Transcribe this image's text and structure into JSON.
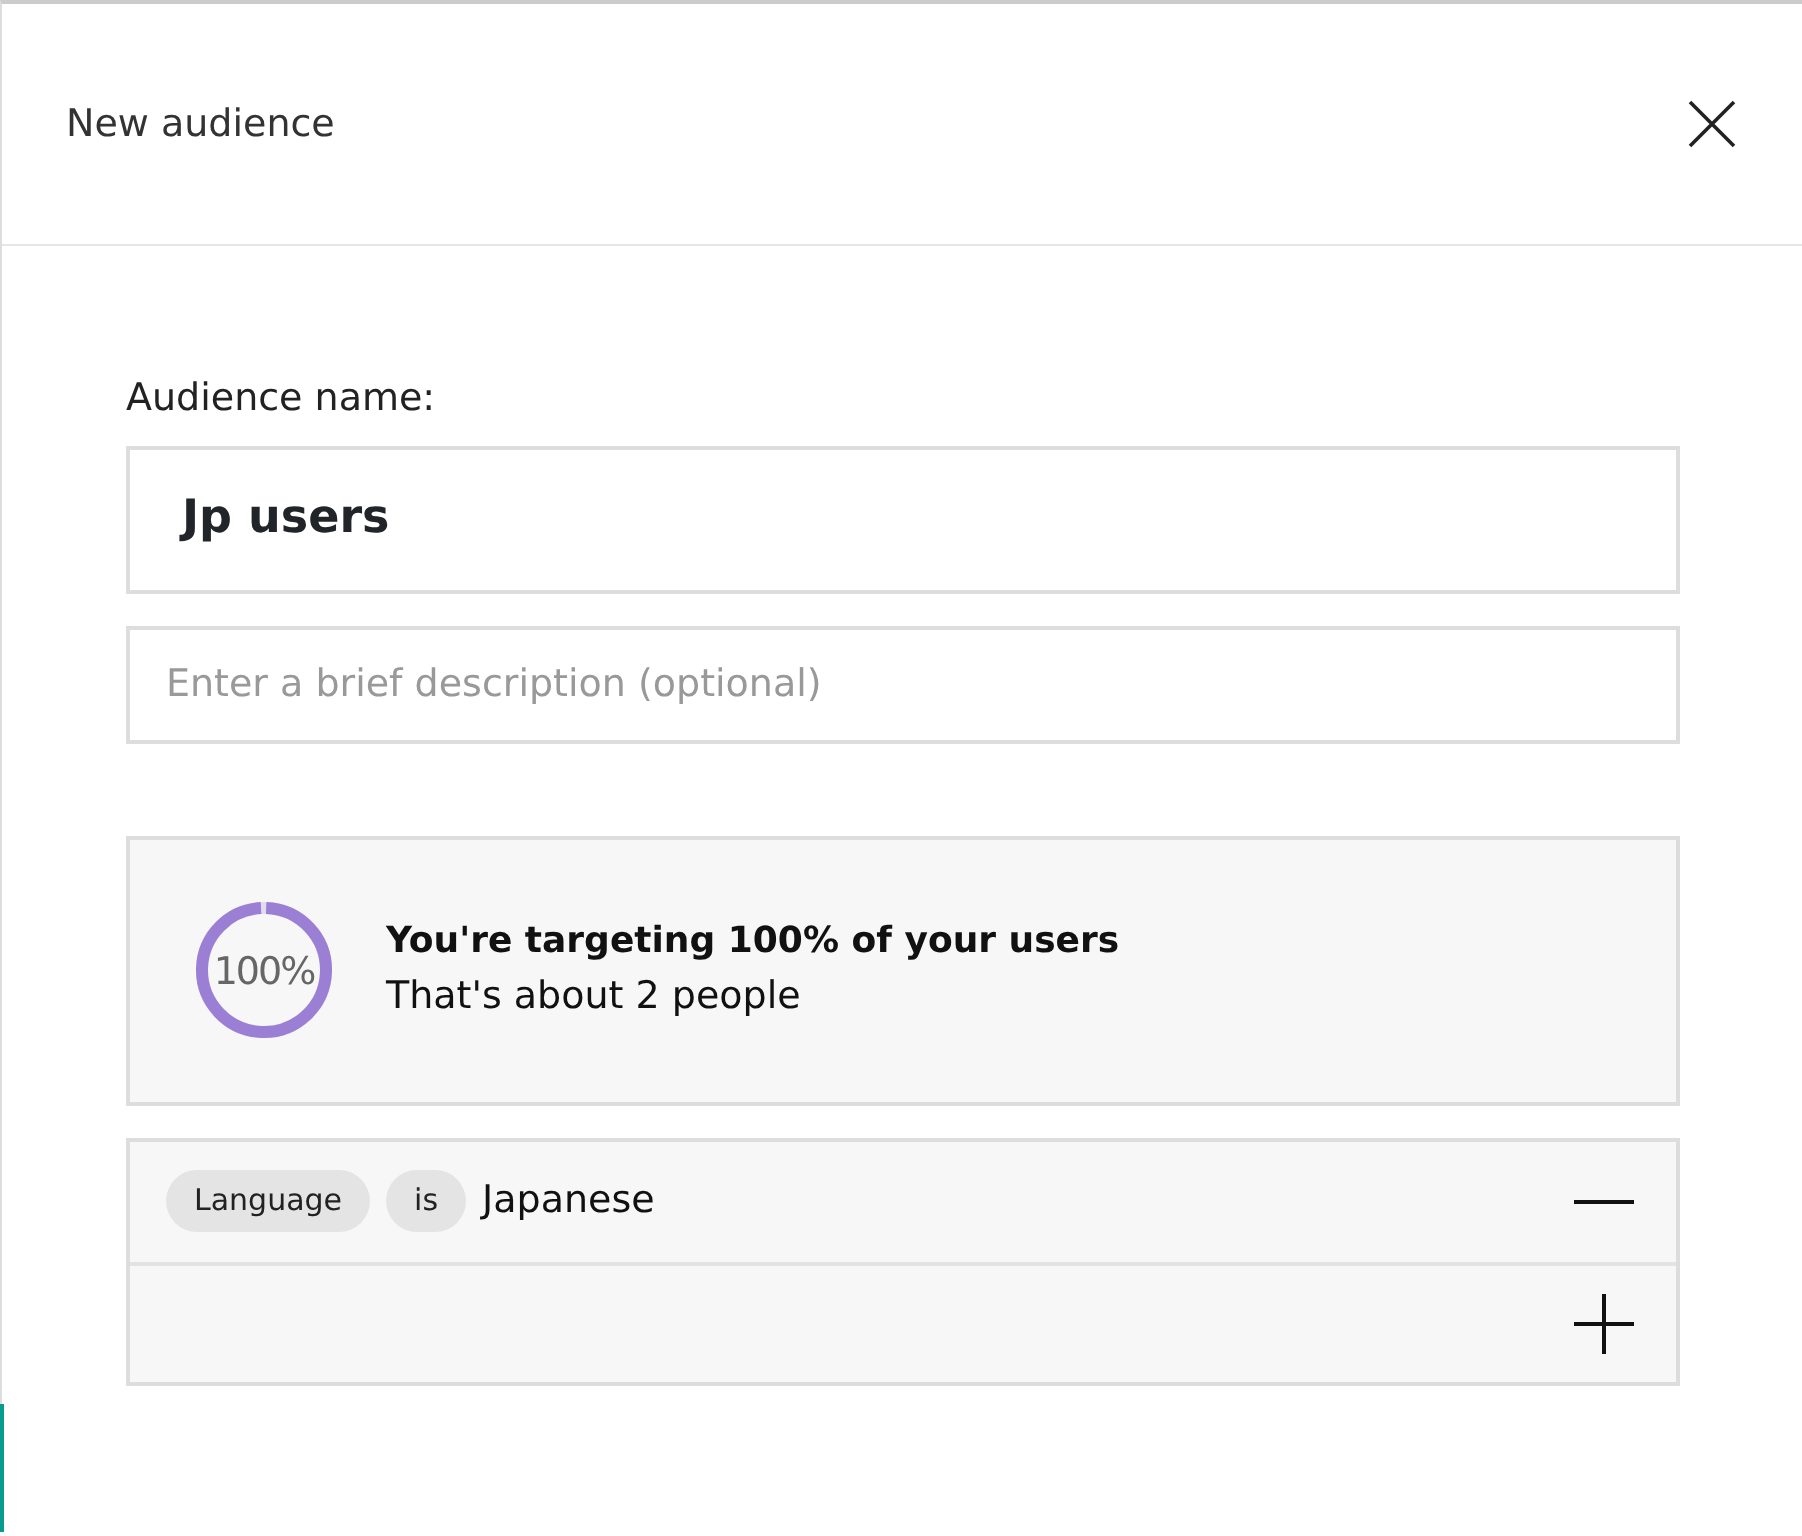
{
  "dialog": {
    "title": "New audience"
  },
  "form": {
    "name_label": "Audience name:",
    "name_value": "Jp users",
    "description_placeholder": "Enter a brief description (optional)"
  },
  "summary": {
    "percent_label": "100%",
    "level": 1,
    "headline": "You're targeting 100% of your users",
    "detail": "That's about 2 people"
  },
  "conditions": [
    {
      "field": "Language",
      "operator": "is",
      "value": "Japanese"
    }
  ]
}
